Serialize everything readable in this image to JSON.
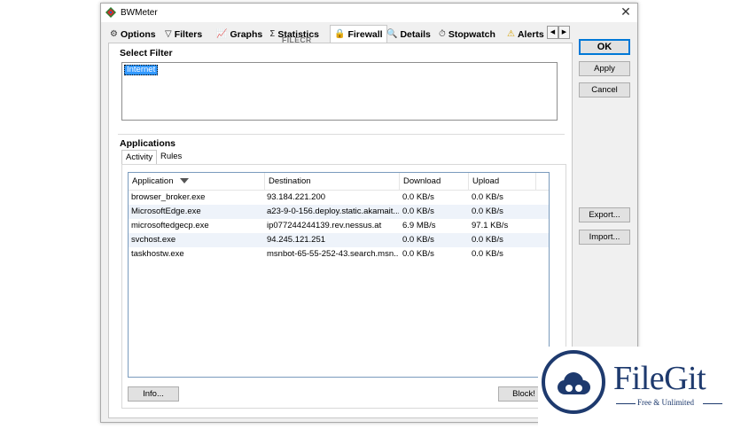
{
  "window": {
    "title": "BWMeter",
    "close_symbol": "✕"
  },
  "tabs": [
    {
      "icon": "gear-icon",
      "glyph": "⚙",
      "label": "Options"
    },
    {
      "icon": "filter-icon",
      "glyph": "▽",
      "label": "Filters"
    },
    {
      "icon": "graph-icon",
      "glyph": "📈",
      "label": "Graphs"
    },
    {
      "icon": "sigma-icon",
      "glyph": "Σ",
      "label": "Statistics"
    },
    {
      "icon": "lock-icon",
      "glyph": "🔒",
      "label": "Firewall"
    },
    {
      "icon": "magnifier-icon",
      "glyph": "🔍",
      "label": "Details"
    },
    {
      "icon": "stopwatch-icon",
      "glyph": "⏱",
      "label": "Stopwatch"
    },
    {
      "icon": "warning-icon",
      "glyph": "⚠",
      "label": "Alerts"
    }
  ],
  "tab_scroll": {
    "left": "◀",
    "right": "▶"
  },
  "select_filter": {
    "title": "Select Filter",
    "items": [
      "Internet"
    ]
  },
  "applications": {
    "title": "Applications",
    "subtabs": [
      "Activity",
      "Rules"
    ],
    "columns": [
      "Application",
      "Destination",
      "Download",
      "Upload"
    ],
    "rows": [
      [
        "browser_broker.exe",
        "93.184.221.200",
        "0.0 KB/s",
        "0.0 KB/s"
      ],
      [
        "MicrosoftEdge.exe",
        "a23-9-0-156.deploy.static.akamait...",
        "0.0 KB/s",
        "0.0 KB/s"
      ],
      [
        "microsoftedgecp.exe",
        "ip077244244139.rev.nessus.at",
        "6.9 MB/s",
        "97.1 KB/s"
      ],
      [
        "svchost.exe",
        "94.245.121.251",
        "0.0 KB/s",
        "0.0 KB/s"
      ],
      [
        "taskhostw.exe",
        "msnbot-65-55-252-43.search.msn....",
        "0.0 KB/s",
        "0.0 KB/s"
      ]
    ],
    "info_button": "Info...",
    "block_button": "Block!"
  },
  "side_buttons": {
    "ok": "OK",
    "apply": "Apply",
    "cancel": "Cancel",
    "export": "Export...",
    "import": "Import..."
  },
  "watermark": {
    "brand": "FileGit",
    "tagline": "Free & Unlimited",
    "overlay": "FILECR"
  },
  "colors": {
    "selection": "#3399ff",
    "default_button_border": "#0078d7",
    "watermark": "#1e3a6e"
  }
}
